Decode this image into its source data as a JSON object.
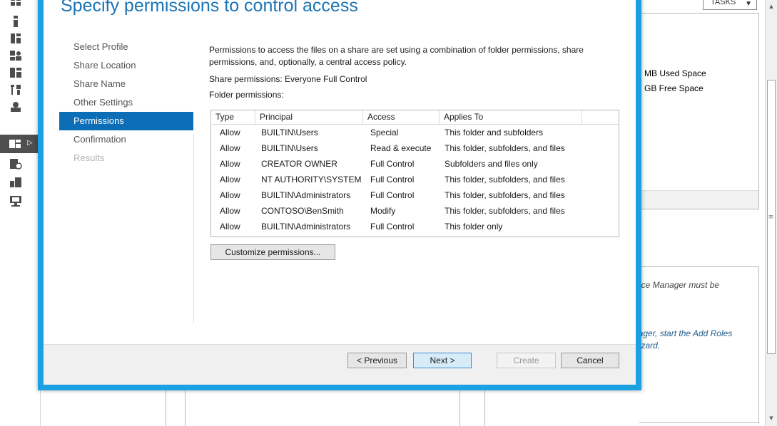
{
  "server_manager": {
    "tasks_label": "TASKS",
    "space": {
      "used": "MB Used Space",
      "free": "GB Free Space"
    },
    "notes": {
      "line1": "urce Manager must be",
      "line2": "nager, start the Add Roles",
      "line3": "Vizard."
    },
    "nav_icons": [
      "dashboard-icon",
      "local-server-icon",
      "all-servers-icon",
      "ad-users-icon",
      "file-services-icon",
      "tools-icon",
      "print-icon",
      "file-storage-icon",
      "iis-icon",
      "remote-access-icon",
      "volume-activation-icon"
    ]
  },
  "wizard": {
    "title": "Specify permissions to control access",
    "steps": [
      {
        "label": "Select Profile",
        "state": "normal"
      },
      {
        "label": "Share Location",
        "state": "normal"
      },
      {
        "label": "Share Name",
        "state": "normal"
      },
      {
        "label": "Other Settings",
        "state": "normal"
      },
      {
        "label": "Permissions",
        "state": "active"
      },
      {
        "label": "Confirmation",
        "state": "normal"
      },
      {
        "label": "Results",
        "state": "disabled"
      }
    ],
    "description": "Permissions to access the files on a share are set using a combination of folder permissions, share permissions, and, optionally, a central access policy.",
    "share_permissions": "Share permissions: Everyone Full Control",
    "folder_permissions_label": "Folder permissions:",
    "table": {
      "headers": [
        "Type",
        "Principal",
        "Access",
        "Applies To"
      ],
      "rows": [
        [
          "Allow",
          "BUILTIN\\Users",
          "Special",
          "This folder and subfolders"
        ],
        [
          "Allow",
          "BUILTIN\\Users",
          "Read & execute",
          "This folder, subfolders, and files"
        ],
        [
          "Allow",
          "CREATOR OWNER",
          "Full Control",
          "Subfolders and files only"
        ],
        [
          "Allow",
          "NT AUTHORITY\\SYSTEM",
          "Full Control",
          "This folder, subfolders, and files"
        ],
        [
          "Allow",
          "BUILTIN\\Administrators",
          "Full Control",
          "This folder, subfolders, and files"
        ],
        [
          "Allow",
          "CONTOSO\\BenSmith",
          "Modify",
          "This folder, subfolders, and files"
        ],
        [
          "Allow",
          "BUILTIN\\Administrators",
          "Full Control",
          "This folder only"
        ]
      ]
    },
    "customize_label": "Customize permissions...",
    "buttons": {
      "previous": "< Previous",
      "next": "Next >",
      "create": "Create",
      "cancel": "Cancel"
    }
  },
  "colors": {
    "accent_border": "#1ba1e2",
    "title_blue": "#1a74b6",
    "active_step": "#0d6eb8"
  }
}
